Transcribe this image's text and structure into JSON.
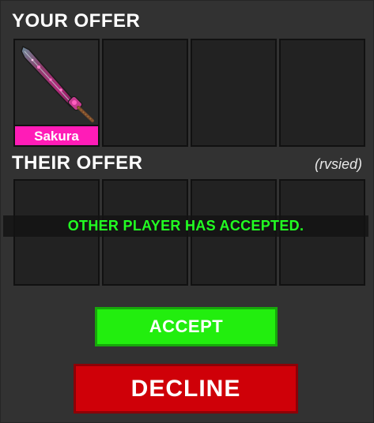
{
  "your_offer": {
    "title": "YOUR OFFER",
    "slots": [
      {
        "item_name": "Sakura",
        "icon": "sakura-knife-icon",
        "label_color": "#ff1cb7"
      },
      {
        "item_name": null
      },
      {
        "item_name": null
      },
      {
        "item_name": null
      }
    ]
  },
  "their_offer": {
    "title": "THEIR OFFER",
    "partner_name": "(rvsied)",
    "slots": [
      {
        "item_name": null
      },
      {
        "item_name": null
      },
      {
        "item_name": null
      },
      {
        "item_name": null
      }
    ],
    "status_banner": "OTHER PLAYER HAS ACCEPTED."
  },
  "buttons": {
    "accept_label": "ACCEPT",
    "decline_label": "DECLINE"
  },
  "colors": {
    "panel_bg": "#323232",
    "slot_bg": "#222222",
    "accepted_text": "#22ff22",
    "accept_button": "#22ee0e",
    "decline_button": "#cf0008",
    "item_label_bg": "#ff1cb7"
  }
}
